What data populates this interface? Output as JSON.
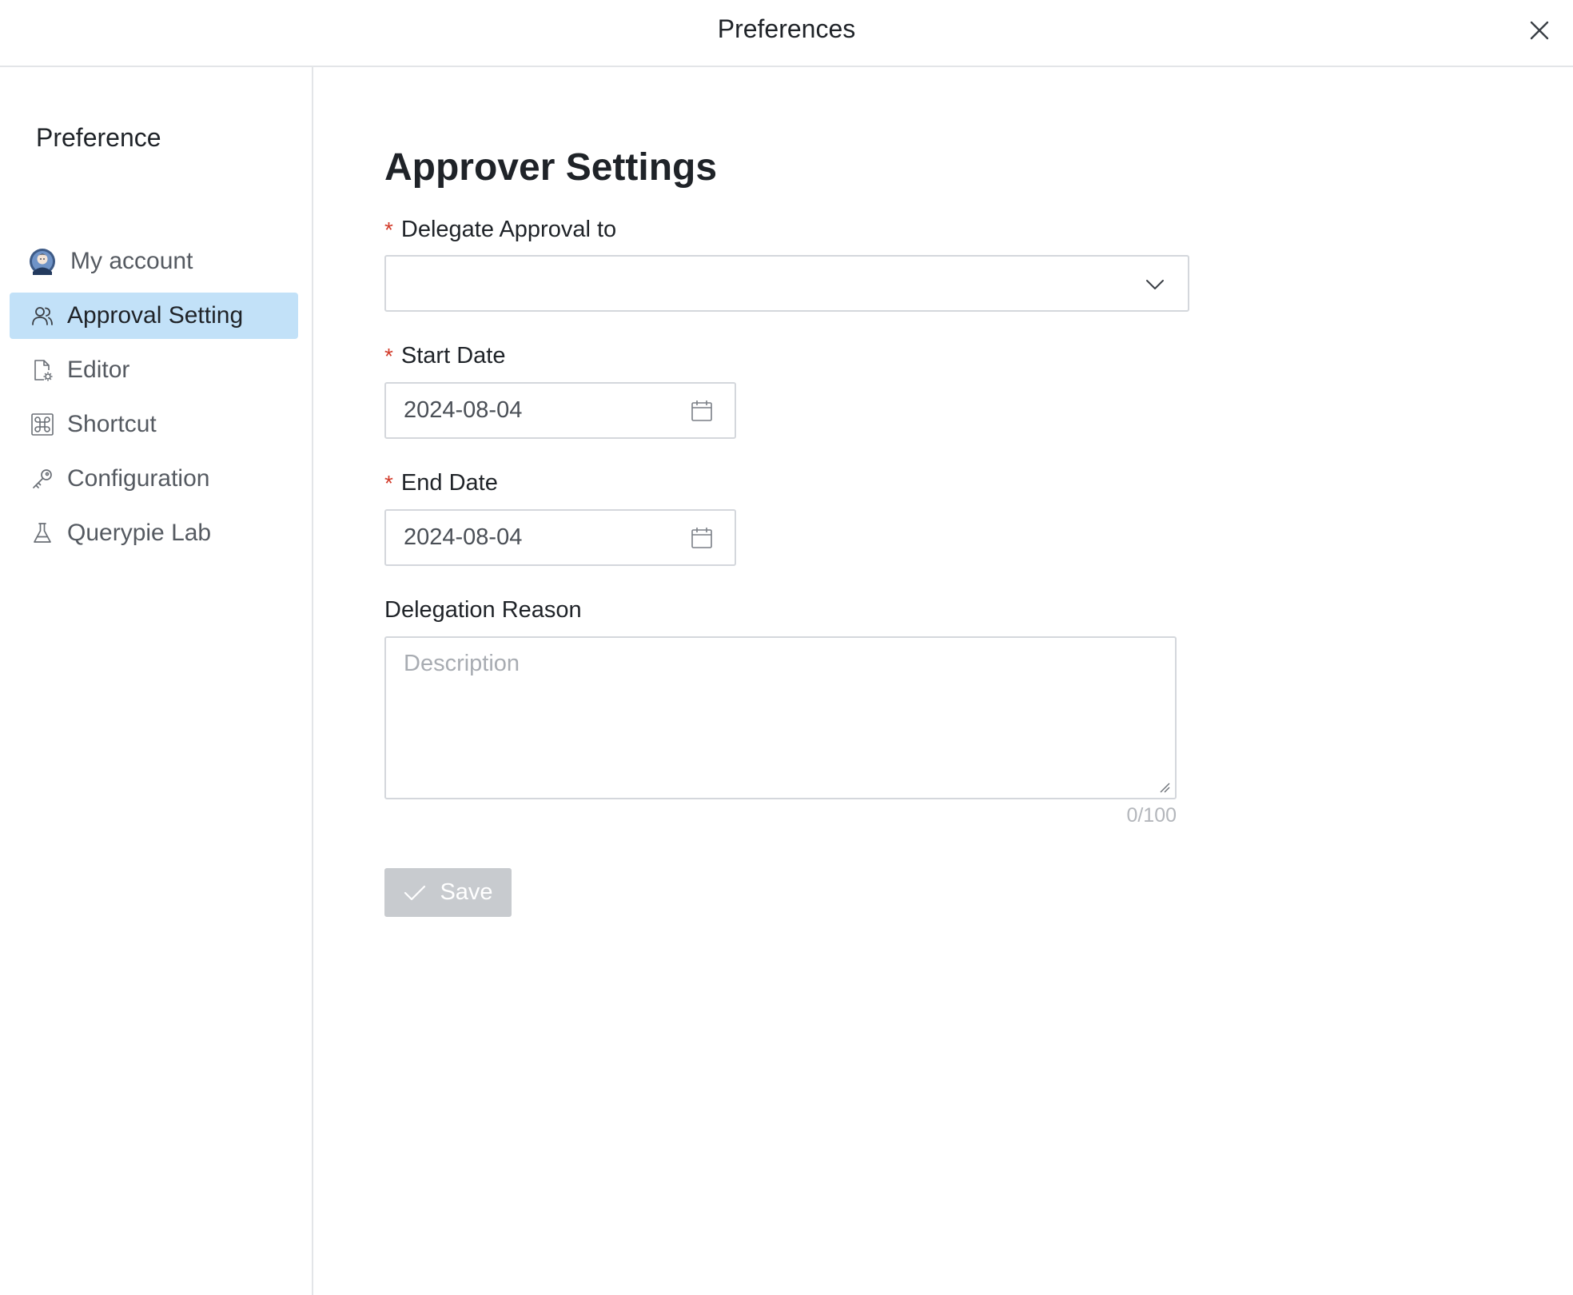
{
  "window": {
    "title": "Preferences"
  },
  "sidebar": {
    "heading": "Preference",
    "items": [
      {
        "label": "My account",
        "icon": "avatar-icon"
      },
      {
        "label": "Approval Setting",
        "icon": "users-icon",
        "active": true
      },
      {
        "label": "Editor",
        "icon": "file-settings-icon"
      },
      {
        "label": "Shortcut",
        "icon": "command-key-icon"
      },
      {
        "label": "Configuration",
        "icon": "key-icon"
      },
      {
        "label": "Querypie Lab",
        "icon": "flask-icon"
      }
    ]
  },
  "main": {
    "title": "Approver Settings",
    "delegate": {
      "label": "Delegate Approval to",
      "required_mark": "*",
      "value": ""
    },
    "start_date": {
      "label": "Start Date",
      "required_mark": "*",
      "value": "2024-08-04"
    },
    "end_date": {
      "label": "End Date",
      "required_mark": "*",
      "value": "2024-08-04"
    },
    "reason": {
      "label": "Delegation Reason",
      "placeholder": "Description",
      "counter": "0/100"
    },
    "save_label": "Save"
  },
  "colors": {
    "active_nav_bg": "#c2e1f8",
    "required": "#d23b2a",
    "disabled_button": "#c8cbcf"
  }
}
